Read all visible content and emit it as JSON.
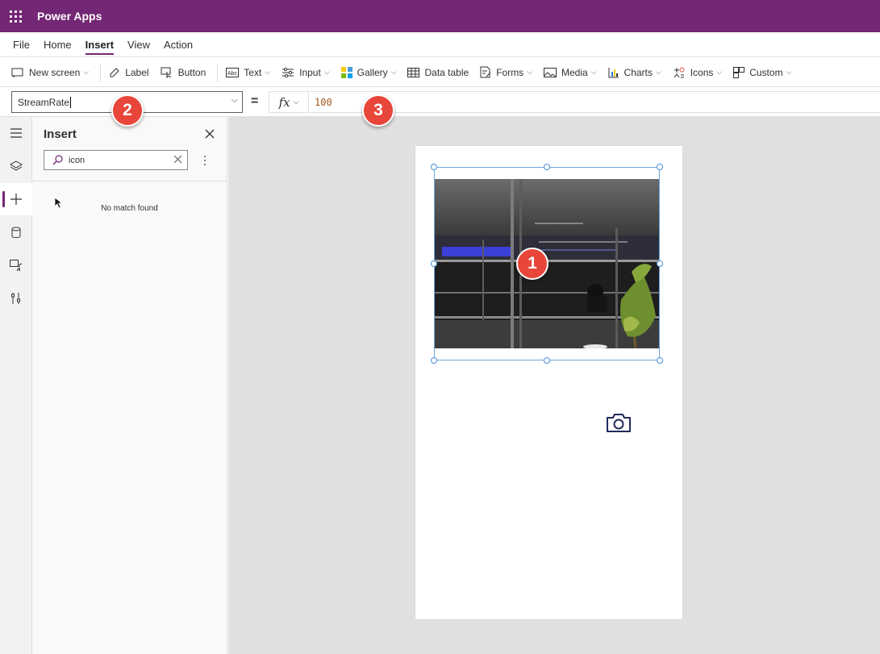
{
  "app": {
    "title": "Power Apps"
  },
  "menu": {
    "items": [
      "File",
      "Home",
      "Insert",
      "View",
      "Action"
    ],
    "active": "Insert"
  },
  "ribbon": {
    "new_screen": "New screen",
    "label": "Label",
    "button": "Button",
    "text": "Text",
    "input": "Input",
    "gallery": "Gallery",
    "data_table": "Data table",
    "forms": "Forms",
    "media": "Media",
    "charts": "Charts",
    "icons": "Icons",
    "custom": "Custom"
  },
  "formula_bar": {
    "property": "StreamRate",
    "equals": "=",
    "fx": "fx",
    "formula": "100"
  },
  "insert_pane": {
    "title": "Insert",
    "search_value": "icon",
    "empty_message": "No match found"
  },
  "callouts": {
    "one": "1",
    "two": "2",
    "three": "3"
  },
  "colors": {
    "brand": "#742774",
    "callout": "#e8463a",
    "selection": "#6fa8dc",
    "formula_number": "#a3561d"
  },
  "icons": [
    "waffle-icon",
    "hamburger-icon",
    "layers-icon",
    "plus-icon",
    "database-icon",
    "media-icon",
    "tools-icon",
    "search-icon",
    "close-icon",
    "camera-icon"
  ]
}
